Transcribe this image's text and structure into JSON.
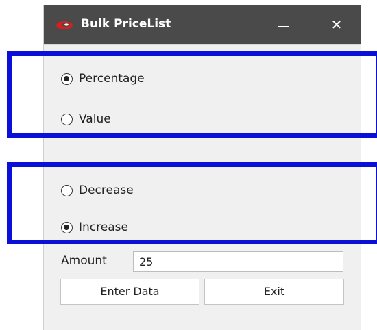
{
  "window": {
    "title": "Bulk PriceList",
    "minimize_label": "",
    "close_label": "✕",
    "logo_color": "#d42020"
  },
  "measure_group": {
    "options": [
      {
        "label": "Percentage",
        "checked": true
      },
      {
        "label": "Value",
        "checked": false
      }
    ]
  },
  "direction_group": {
    "options": [
      {
        "label": "Decrease",
        "checked": false
      },
      {
        "label": "Increase",
        "checked": true
      }
    ]
  },
  "amount": {
    "label": "Amount",
    "value": "25"
  },
  "buttons": {
    "enter_data": "Enter Data",
    "exit": "Exit"
  },
  "annotation": {
    "highlight_color": "#0a10d8"
  }
}
